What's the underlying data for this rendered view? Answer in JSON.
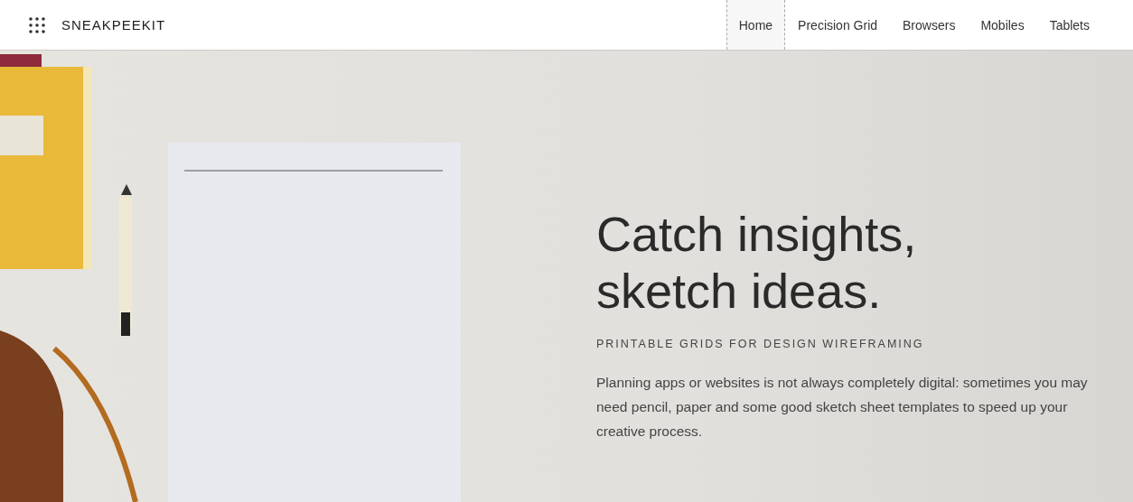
{
  "header": {
    "brand": "SNEAKPEEKIT",
    "nav": [
      {
        "label": "Home",
        "selected": true
      },
      {
        "label": "Precision Grid",
        "selected": false
      },
      {
        "label": "Browsers",
        "selected": false
      },
      {
        "label": "Mobiles",
        "selected": false
      },
      {
        "label": "Tablets",
        "selected": false
      }
    ]
  },
  "hero": {
    "headline_lines": [
      "Catch insights,",
      "sketch ideas."
    ],
    "subtitle": "PRINTABLE GRIDS FOR DESIGN WIREFRAMING",
    "body": "Planning apps or websites is not always completely digital: sometimes you may need pencil, paper and some good sketch sheet templates to speed up your creative process."
  }
}
